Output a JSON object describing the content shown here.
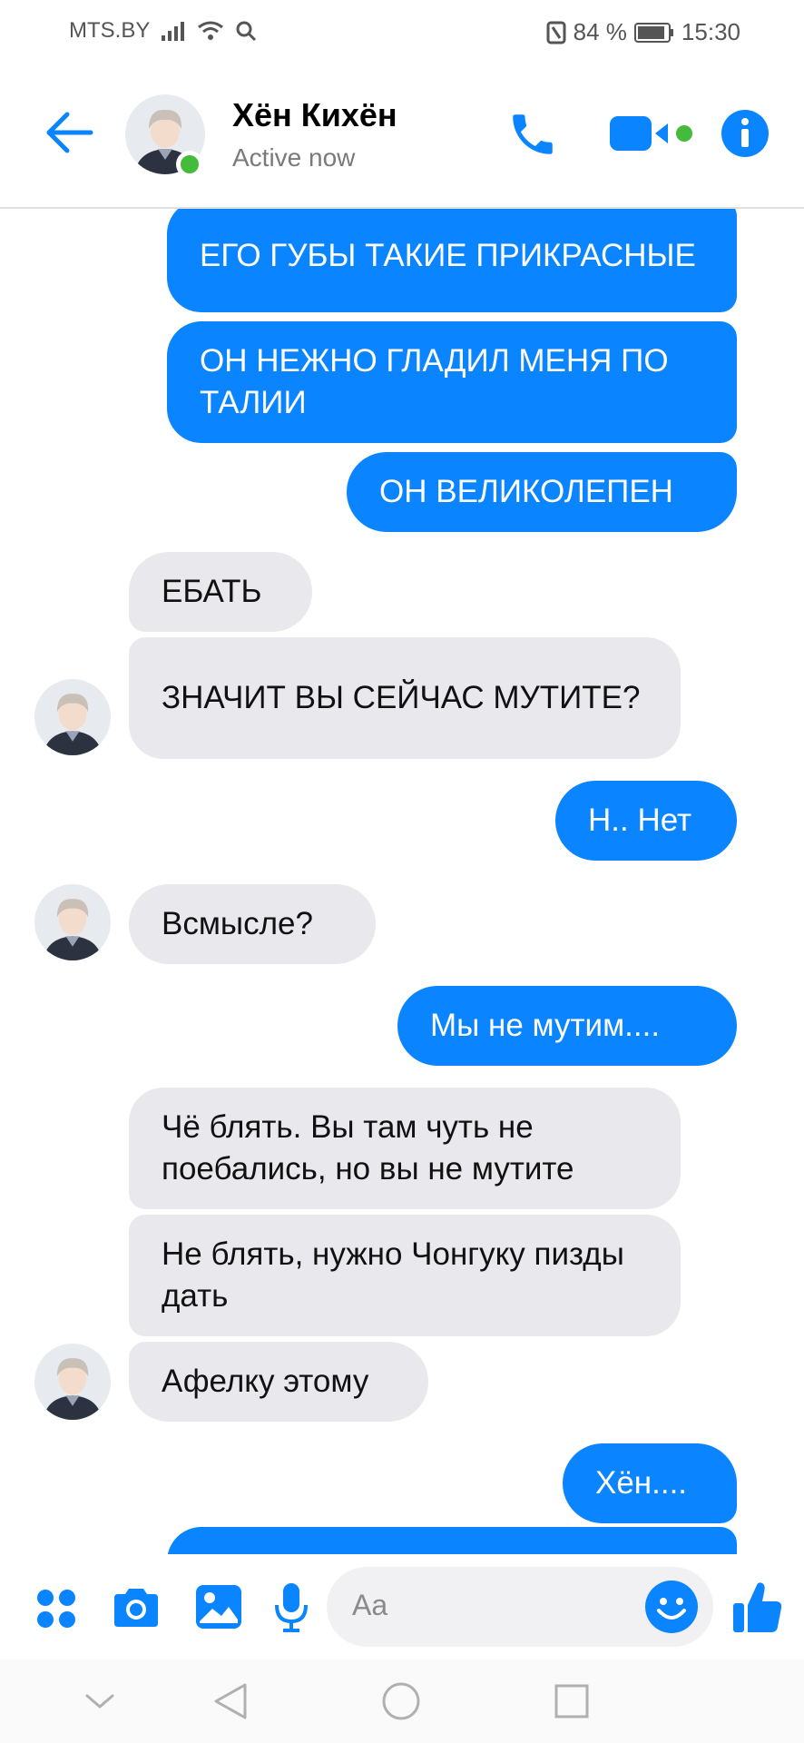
{
  "status_bar": {
    "carrier": "MTS.BY",
    "battery": "84 %",
    "time": "15:30"
  },
  "header": {
    "contact_name": "Хён Кихён",
    "status": "Active now"
  },
  "messages": [
    {
      "dir": "out",
      "text": "ЕГО ГУБЫ ТАКИЕ ПРИКРАСНЫЕ"
    },
    {
      "dir": "out",
      "text": "ОН НЕЖНО ГЛАДИЛ МЕНЯ ПО ТАЛИИ"
    },
    {
      "dir": "out",
      "text": "ОН ВЕЛИКОЛЕПЕН"
    },
    {
      "dir": "in",
      "text": "ЕБАТЬ"
    },
    {
      "dir": "in",
      "text": "ЗНАЧИТ ВЫ СЕЙЧАС МУТИТЕ?"
    },
    {
      "dir": "out",
      "text": "Н.. Нет"
    },
    {
      "dir": "in",
      "text": "Всмысле?"
    },
    {
      "dir": "out",
      "text": "Мы не мутим...."
    },
    {
      "dir": "in",
      "text": "Чё блять. Вы там чуть не поебались, но вы не мутите"
    },
    {
      "dir": "in",
      "text": "Не блять, нужно Чонгуку пизды дать"
    },
    {
      "dir": "in",
      "text": "Афелку этому"
    },
    {
      "dir": "out",
      "text": "Хён...."
    }
  ],
  "composer": {
    "placeholder": "Aa"
  },
  "colors": {
    "accent": "#0a84ff",
    "incoming_bubble": "#e9e8ec",
    "active_green": "#44bb3b"
  },
  "icons": {
    "header": [
      "back-arrow-icon",
      "phone-icon",
      "video-call-icon",
      "info-icon"
    ],
    "composer": [
      "apps-icon",
      "camera-icon",
      "gallery-icon",
      "microphone-icon",
      "emoji-icon",
      "like-icon"
    ],
    "nav": [
      "nav-collapse-icon",
      "nav-back-icon",
      "nav-home-icon",
      "nav-recents-icon"
    ]
  }
}
